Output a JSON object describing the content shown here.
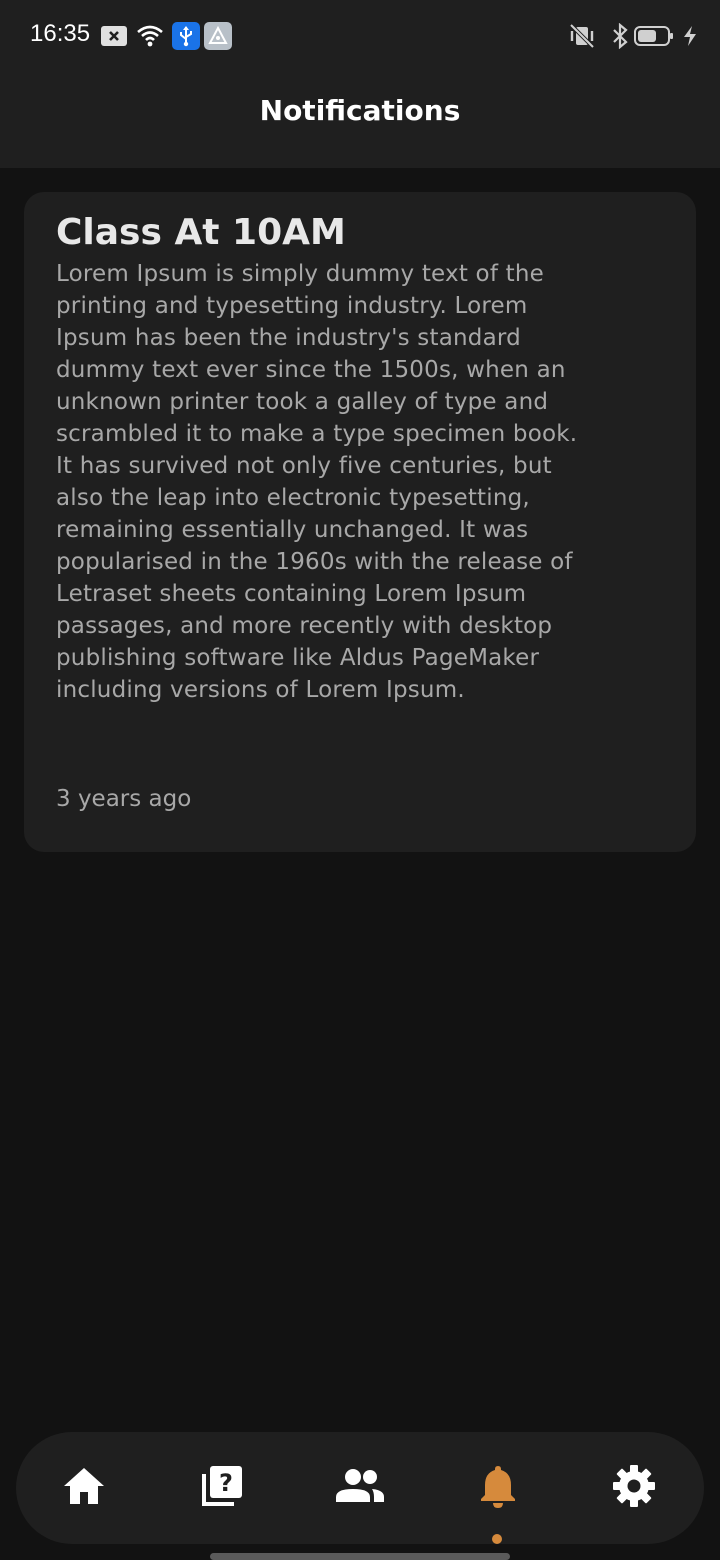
{
  "status_bar": {
    "time": "16:35",
    "icons": [
      "close-box-icon",
      "wifi-icon",
      "usb-icon",
      "app-icon",
      "vibrate-off-icon",
      "bluetooth-icon",
      "battery-icon",
      "charging-icon"
    ]
  },
  "app_bar": {
    "title": "Notifications"
  },
  "notifications": [
    {
      "title": "Class At 10AM",
      "body": "Lorem Ipsum is simply dummy text of the printing and typesetting industry. Lorem Ipsum has been the industry's standard dummy text ever since the 1500s, when an unknown printer took a galley of type and scrambled it to make a type specimen book. It has survived not only five centuries, but also the leap into electronic typesetting, remaining essentially unchanged. It was popularised in the 1960s with the release of Letraset sheets containing Lorem Ipsum passages, and more recently with desktop publishing software like Aldus PageMaker including versions of Lorem Ipsum.",
      "time": "3 years ago"
    }
  ],
  "bottom_nav": {
    "items": [
      {
        "icon": "home-icon",
        "active": false
      },
      {
        "icon": "quiz-icon",
        "active": false
      },
      {
        "icon": "people-icon",
        "active": false
      },
      {
        "icon": "bell-icon",
        "active": true
      },
      {
        "icon": "settings-icon",
        "active": false
      }
    ],
    "active_color": "#d68a3c",
    "inactive_color": "#ffffff"
  },
  "colors": {
    "background": "#121212",
    "surface": "#1f1f1f",
    "accent": "#d68a3c"
  }
}
